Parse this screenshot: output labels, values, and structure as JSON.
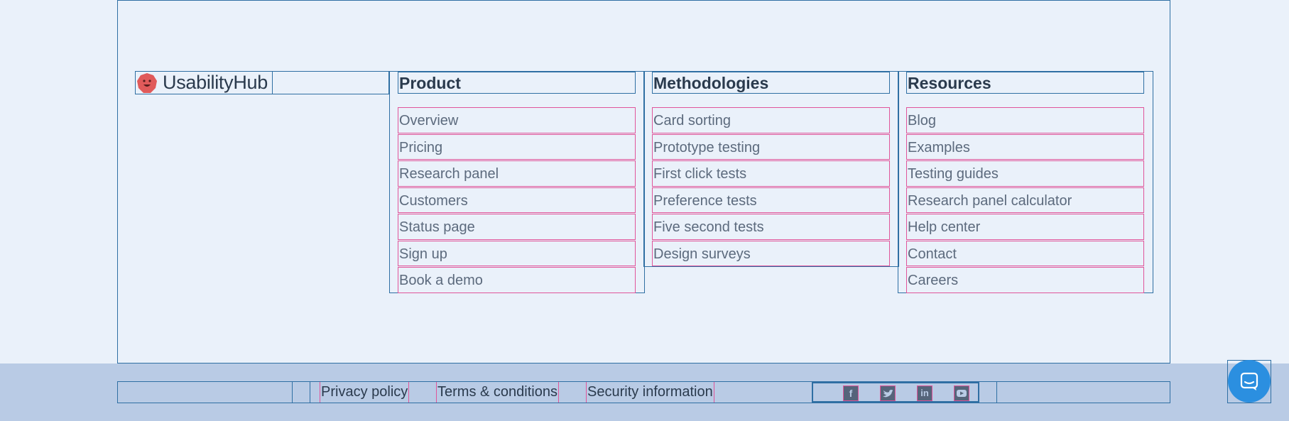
{
  "brand": {
    "name": "UsabilityHub",
    "logo_icon": "smiley-blob-logo",
    "logo_color": "#e05a5a"
  },
  "columns": [
    {
      "title": "Product",
      "items": [
        "Overview",
        "Pricing",
        "Research panel",
        "Customers",
        "Status page",
        "Sign up",
        "Book a demo"
      ]
    },
    {
      "title": "Methodologies",
      "items": [
        "Card sorting",
        "Prototype testing",
        "First click tests",
        "Preference tests",
        "Five second tests",
        "Design surveys"
      ]
    },
    {
      "title": "Resources",
      "items": [
        "Blog",
        "Examples",
        "Testing guides",
        "Research panel calculator",
        "Help center",
        "Contact",
        "Careers"
      ]
    }
  ],
  "footer": {
    "links": [
      "Privacy policy",
      "Terms & conditions",
      "Security information"
    ],
    "social": [
      "facebook-icon",
      "twitter-icon",
      "linkedin-icon",
      "youtube-icon"
    ]
  },
  "chat": {
    "icon": "chat-bubble-icon",
    "color": "#2b8fe0"
  }
}
